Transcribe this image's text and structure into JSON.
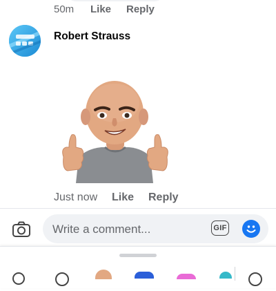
{
  "previous_comment": {
    "time": "50m",
    "like_label": "Like",
    "reply_label": "Reply"
  },
  "comment": {
    "author": "Robert Strauss",
    "time": "Just now",
    "like_label": "Like",
    "reply_label": "Reply",
    "sticker": "avatar-thumbs-up-sticker"
  },
  "composer": {
    "placeholder": "Write a comment...",
    "gif_label": "GIF",
    "camera_icon": "camera-icon",
    "emoji_icon": "emoji-smile-icon"
  },
  "sticker_tray": {
    "tabs": [
      "search-icon",
      "clock-icon",
      "avatar-sticker",
      "sticker-pack-blue",
      "sticker-pack-pink",
      "sticker-pack-teal",
      "add-icon"
    ]
  },
  "colors": {
    "accent": "#1877f2",
    "secondary_text": "#65676b",
    "bubble": "#f0f2f5"
  }
}
